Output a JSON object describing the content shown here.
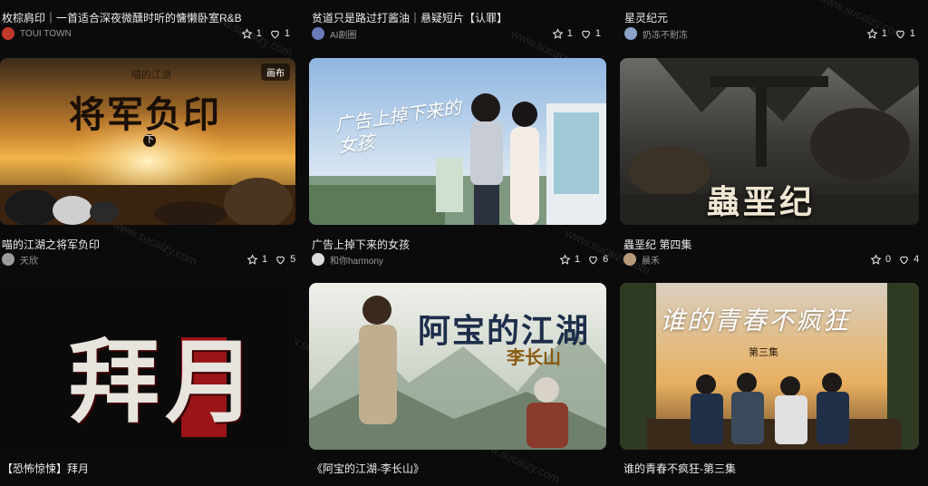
{
  "colors": {
    "background": "#0b0b0c",
    "text": "#ececec",
    "muted": "#9a9a9a"
  },
  "watermark": "www.sucaizy.com",
  "cards": [
    {
      "title": "枚棕肩印｜一首适合深夜微醺时听的慵懒卧室R&B",
      "author": "TOUI TOWN",
      "stars": "1",
      "likes": "1"
    },
    {
      "title": "贫道只是路过打酱油｜悬疑短片【认罪】",
      "author": "AI剧圈",
      "stars": "1",
      "likes": "1"
    },
    {
      "title": "星灵纪元",
      "author": "奶冻不耐冻",
      "stars": "1",
      "likes": "1"
    },
    {
      "title": "喵的江湖之将军负印",
      "author": "天欣",
      "stars": "1",
      "likes": "5",
      "badge": "画布",
      "thumb_text": "将军负印",
      "thumb_sub": "喵的江湖",
      "thumb_mark": "下"
    },
    {
      "title": "广告上掉下来的女孩",
      "author": "和你harmony",
      "stars": "1",
      "likes": "6",
      "thumb_text": "广告上掉下来的女孩"
    },
    {
      "title": "蟲垩纪 第四集",
      "author": "晨禾",
      "stars": "0",
      "likes": "4",
      "thumb_text": "蟲垩纪"
    },
    {
      "title": "【恐怖惊悚】拜月",
      "thumb_text": "拜月"
    },
    {
      "title": "《阿宝的江湖-李长山》",
      "thumb_text": "阿宝的江湖",
      "thumb_sub": "李长山"
    },
    {
      "title": "谁的青春不疯狂-第三集",
      "thumb_text": "谁的青春不疯狂",
      "thumb_sub": "第三集"
    }
  ]
}
